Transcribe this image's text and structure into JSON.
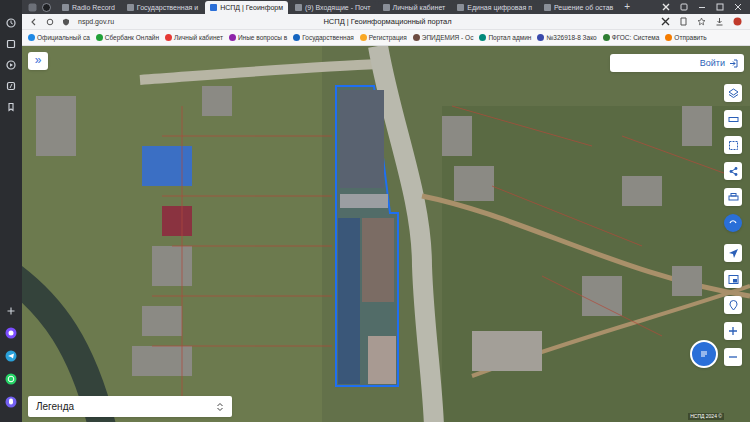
{
  "browser": {
    "tabs": [
      {
        "label": "Radio Record",
        "selected": false
      },
      {
        "label": "Государственная и",
        "selected": false
      },
      {
        "label": "НСПД | Геоинформ",
        "selected": true
      },
      {
        "label": "(9) Входящие - Почт",
        "selected": false
      },
      {
        "label": "Личный кабинет",
        "selected": false
      },
      {
        "label": "Единая цифровая п",
        "selected": false
      },
      {
        "label": "Решение об остав",
        "selected": false
      }
    ],
    "new_tab": "+",
    "address": "nspd.gov.ru",
    "page_title": "НСПД | Геоинформационный портал"
  },
  "bookmarks": [
    "Официальный са",
    "Сбербанк Онлайн",
    "Личный кабинет",
    "Иные вопросы в",
    "Государственная",
    "Регистрация",
    "ЭПИДЕМИЯ - Ос",
    "Портал админ",
    "№326918-8 Зако",
    "ФГОС: Система",
    "Отправить"
  ],
  "map": {
    "panel_toggle": "»",
    "login": "Войти",
    "legend": "Легенда",
    "attribution": "НСПД 2024 ©"
  }
}
